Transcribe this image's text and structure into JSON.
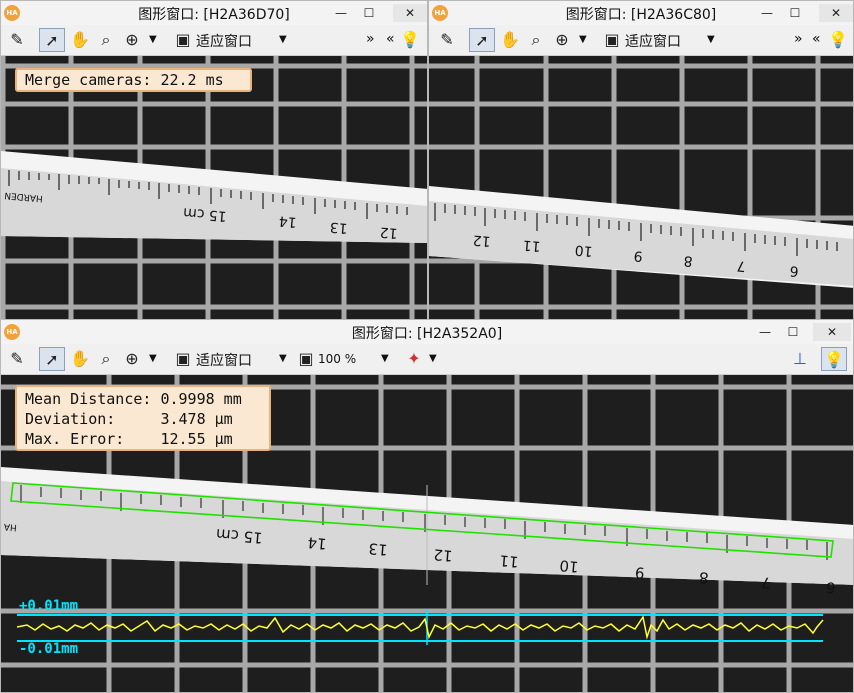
{
  "windows": [
    {
      "title": "图形窗口: [H2A36D70]",
      "overlay": {
        "lines": [
          "Merge cameras: 22.2 ms"
        ]
      },
      "ruler_numbers": [
        "15 cm",
        "14",
        "13",
        "12"
      ],
      "ruler_brand": "HARDEN"
    },
    {
      "title": "图形窗口: [H2A36C80]",
      "ruler_numbers": [
        "12",
        "11",
        "10",
        "9",
        "8",
        "7",
        "6"
      ]
    },
    {
      "title": "图形窗口: [H2A352A0]",
      "overlay": {
        "lines": [
          "Mean Distance: 0.9998 mm",
          "Deviation:     3.478 µm",
          "Max. Error:    12.55 µm"
        ]
      },
      "ruler_numbers": [
        "15 cm",
        "14",
        "13",
        "12",
        "11",
        "10",
        "9",
        "8",
        "7",
        "6"
      ],
      "ruler_brand": "HA",
      "plot": {
        "upper_label": "+0.01mm",
        "lower_label": "-0.01mm"
      }
    }
  ],
  "toolbar": {
    "fit_window_label": "适应窗口",
    "zoom_label": "100 %",
    "more_right": "»",
    "more_left": "«"
  },
  "window_controls": {
    "minimize": "—",
    "maximize": "☐",
    "close": "✕"
  },
  "icons": [
    "pencil-icon",
    "pointer-icon",
    "hand-icon",
    "magnifier-icon",
    "zoom-in-icon",
    "fit-window-icon",
    "zoom-image-icon",
    "color-picker-icon",
    "coordinate-axes-icon",
    "lightbulb-icon"
  ],
  "colors": {
    "overlay_bg": "#fbe8d2",
    "overlay_border": "#e9b27a",
    "rect_green": "#22e000",
    "plot_yellow": "#ffff33",
    "plot_cyan": "#00e5ff",
    "logo_orange": "#f2a23a"
  }
}
